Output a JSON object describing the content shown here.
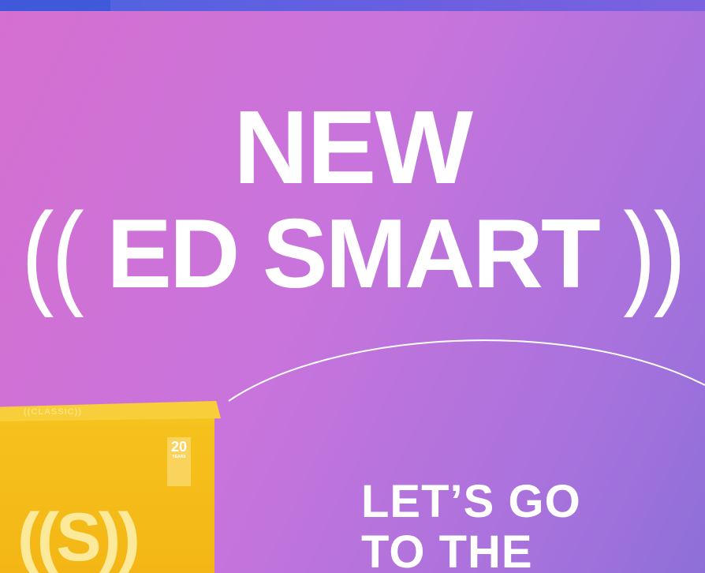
{
  "headline": {
    "line1": "NEW",
    "open_paren": "((",
    "brand": "ED SMART",
    "close_paren": "))"
  },
  "product_box": {
    "top_label": "((CLASSIC))",
    "badge_number": "20",
    "badge_years": "YEARS",
    "logo": "((S))"
  },
  "cta": {
    "line1": "LET’S GO",
    "line2": "TO THE"
  },
  "colors": {
    "gradient_start": "#d56fd0",
    "gradient_end": "#8e6fd8",
    "box_yellow": "#f6c21d",
    "text": "#ffffff"
  }
}
